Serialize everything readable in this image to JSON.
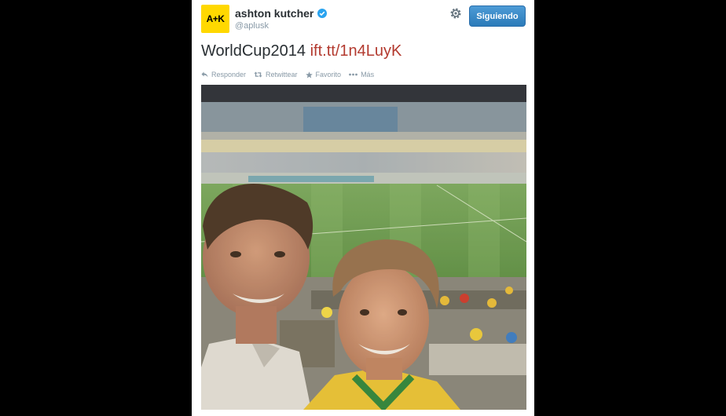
{
  "profile": {
    "avatar_text": "A+K",
    "name": "ashton kutcher",
    "handle": "@aplusk"
  },
  "header": {
    "follow_label": "Siguiendo"
  },
  "tweet": {
    "text": "WorldCup2014",
    "link": "ift.tt/1n4LuyK"
  },
  "actions": [
    {
      "label": "Responder",
      "icon": "reply-icon"
    },
    {
      "label": "Retwittear",
      "icon": "retweet-icon"
    },
    {
      "label": "Favorito",
      "icon": "star-icon"
    },
    {
      "label": "Más",
      "icon": "more-icon"
    }
  ],
  "colors": {
    "follow_button": "#2b7bb9",
    "link": "#b33a2f",
    "avatar_bg": "#ffd800",
    "verified": "#2aa3ef"
  }
}
